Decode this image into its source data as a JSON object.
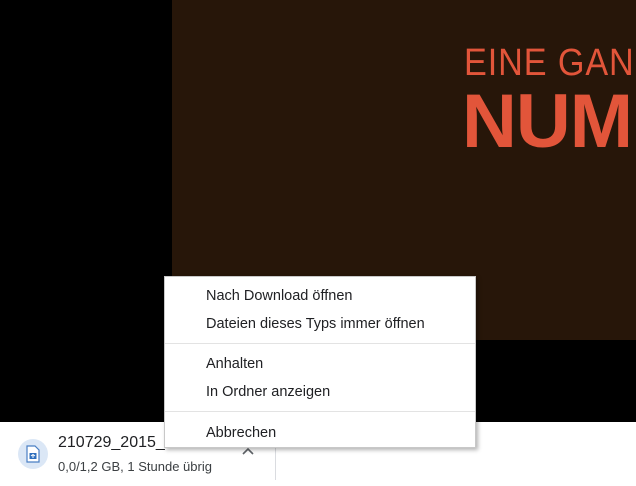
{
  "video": {
    "title_line1": "EINE GAN",
    "title_line2": "NUM"
  },
  "download": {
    "filename": "210729_2015_s",
    "status": "0,0/1,2 GB, 1 Stunde übrig",
    "icon": "file-icon"
  },
  "context_menu": {
    "items": [
      {
        "label": "Nach Download öffnen"
      },
      {
        "label": "Dateien dieses Typs immer öffnen"
      },
      {
        "label": "Anhalten"
      },
      {
        "label": "In Ordner anzeigen"
      },
      {
        "label": "Abbrechen"
      }
    ]
  },
  "colors": {
    "video_background": "#271609",
    "title_accent": "#e2553a",
    "menu_background": "#ffffff",
    "shelf_background": "#ffffff"
  }
}
